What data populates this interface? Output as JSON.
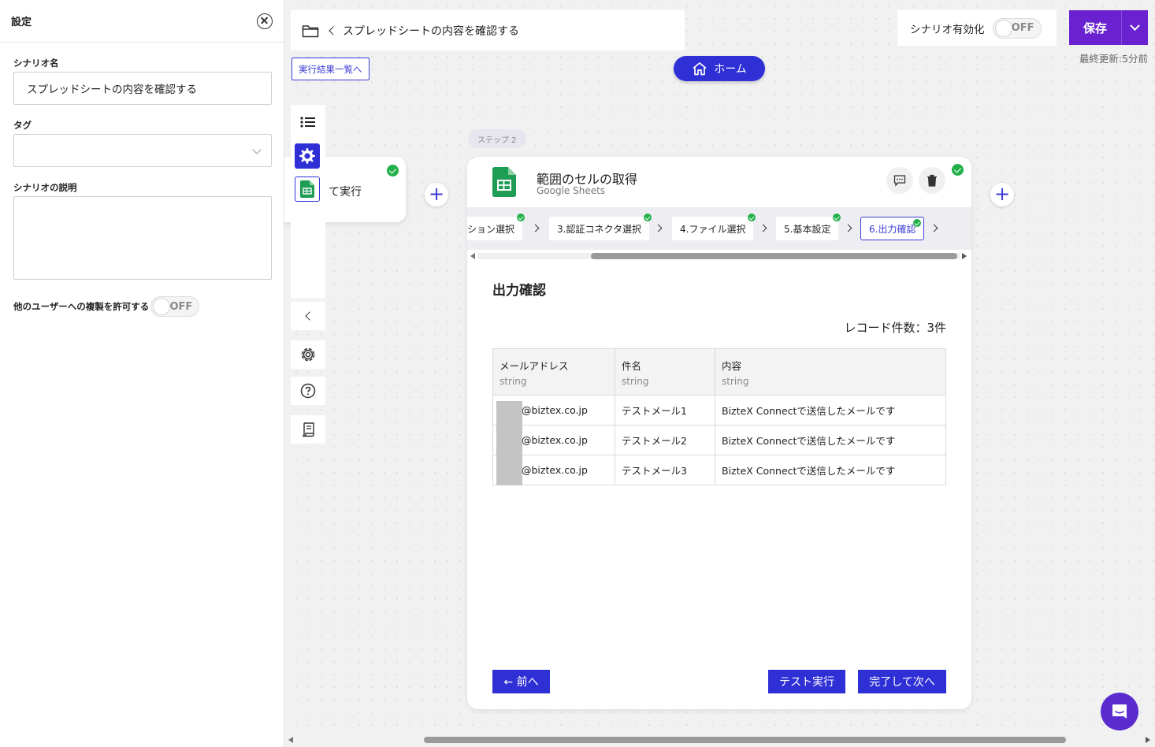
{
  "settings_panel": {
    "title": "設定",
    "scenario_name_label": "シナリオ名",
    "scenario_name_value": "スプレッドシートの内容を確認する",
    "tag_label": "タグ",
    "tag_value": "",
    "description_label": "シナリオの説明",
    "description_value": "",
    "allow_copy_label": "他のユーザーへの複製を許可する",
    "allow_copy_toggle": "OFF"
  },
  "topbar": {
    "breadcrumb_title": "スプレッドシートの内容を確認する",
    "results_link": "実行結果一覧へ",
    "home_label": "ホーム",
    "scenario_enable_label": "シナリオ有効化",
    "scenario_enable_toggle": "OFF",
    "save_label": "保存",
    "last_updated": "最終更新:5分前"
  },
  "step1": {
    "partial_text": "て実行"
  },
  "step2": {
    "badge": "ステップ 2",
    "app_title": "範囲のセルの取得",
    "app_subtitle": "Google Sheets",
    "tabs": [
      {
        "label": "ション選択"
      },
      {
        "label": "3.認証コネクタ選択"
      },
      {
        "label": "4.ファイル選択"
      },
      {
        "label": "5.基本設定"
      },
      {
        "label": "6.出力確認"
      }
    ],
    "section_title": "出力確認",
    "record_count": "レコード件数：3件",
    "table": {
      "headers": [
        {
          "name": "メールアドレス",
          "type": "string"
        },
        {
          "name": "件名",
          "type": "string"
        },
        {
          "name": "内容",
          "type": "string"
        }
      ],
      "rows": [
        [
          "@biztex.co.jp",
          "テストメール1",
          "BizteX Connectで送信したメールです"
        ],
        [
          "@biztex.co.jp",
          "テストメール2",
          "BizteX Connectで送信したメールです"
        ],
        [
          "@biztex.co.jp",
          "テストメール3",
          "BizteX Connectで送信したメールです"
        ]
      ]
    },
    "prev_button": "← 前へ",
    "test_button": "テスト実行",
    "next_button": "完了して次へ"
  },
  "colors": {
    "accent": "#2f2fd6",
    "save": "#6a21cf",
    "success": "#21b04a",
    "sheets_green": "#1e9e55"
  }
}
